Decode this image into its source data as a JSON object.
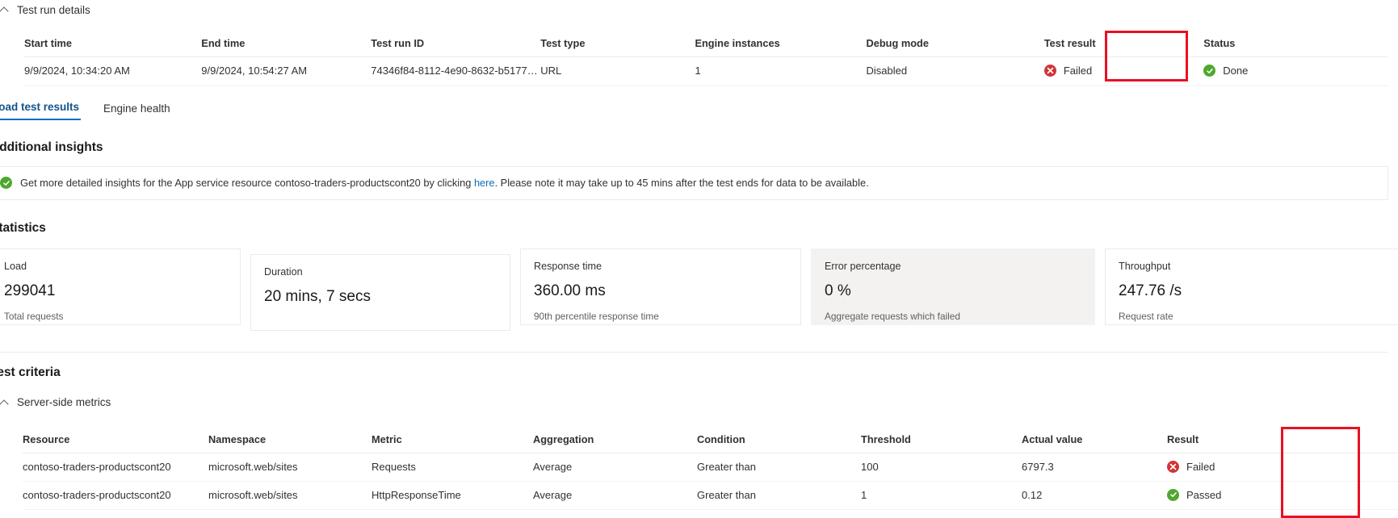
{
  "run_details": {
    "section_title": "Test run details",
    "columns": [
      "Start time",
      "End time",
      "Test run ID",
      "Test type",
      "Engine instances",
      "Debug mode",
      "Test result",
      "Status"
    ],
    "row": {
      "start_time": "9/9/2024, 10:34:20 AM",
      "end_time": "9/9/2024, 10:54:27 AM",
      "test_run_id": "74346f84-8112-4e90-8632-b51773b...",
      "test_type": "URL",
      "engine_instances": "1",
      "debug_mode": "Disabled",
      "test_result": "Failed",
      "test_result_icon": "error-circle-icon",
      "status": "Done",
      "status_icon": "success-circle-icon"
    }
  },
  "tabs": [
    {
      "label": "Load test results",
      "active": true
    },
    {
      "label": "Engine health",
      "active": false
    }
  ],
  "insights": {
    "heading": "Additional insights",
    "icon": "success-circle-icon",
    "text_before": "Get more detailed insights for the App service resource contoso-traders-productscont20 by clicking",
    "link": "here",
    "text_after": ". Please note it may take up to 45 mins after the test ends for data to be available."
  },
  "statistics": {
    "heading": "Statistics",
    "cards": [
      {
        "title": "Load",
        "value": "299041",
        "sub": "Total requests",
        "highlighted": false
      },
      {
        "title": "Duration",
        "value": "20 mins, 7 secs",
        "sub": "",
        "highlighted": false
      },
      {
        "title": "Response time",
        "value": "360.00 ms",
        "sub": "90th percentile response time",
        "highlighted": false
      },
      {
        "title": "Error percentage",
        "value": "0 %",
        "sub": "Aggregate requests which failed",
        "highlighted": true
      },
      {
        "title": "Throughput",
        "value": "247.76 /s",
        "sub": "Request rate",
        "highlighted": false
      }
    ]
  },
  "test_criteria": {
    "heading": "Test criteria",
    "group_title": "Server-side metrics",
    "columns": [
      "Resource",
      "Namespace",
      "Metric",
      "Aggregation",
      "Condition",
      "Threshold",
      "Actual value",
      "Result"
    ],
    "rows": [
      {
        "resource": "contoso-traders-productscont20",
        "namespace": "microsoft.web/sites",
        "metric": "Requests",
        "aggregation": "Average",
        "condition": "Greater than",
        "threshold": "100",
        "actual_value": "6797.3",
        "result": "Failed",
        "result_icon": "error-circle-icon"
      },
      {
        "resource": "contoso-traders-productscont20",
        "namespace": "microsoft.web/sites",
        "metric": "HttpResponseTime",
        "aggregation": "Average",
        "condition": "Greater than",
        "threshold": "1",
        "actual_value": "0.12",
        "result": "Passed",
        "result_icon": "success-circle-icon"
      }
    ]
  },
  "colors": {
    "fail": "#d13438",
    "pass": "#4ea72e",
    "accent": "#0f6cbd",
    "annotation": "#e81123"
  }
}
